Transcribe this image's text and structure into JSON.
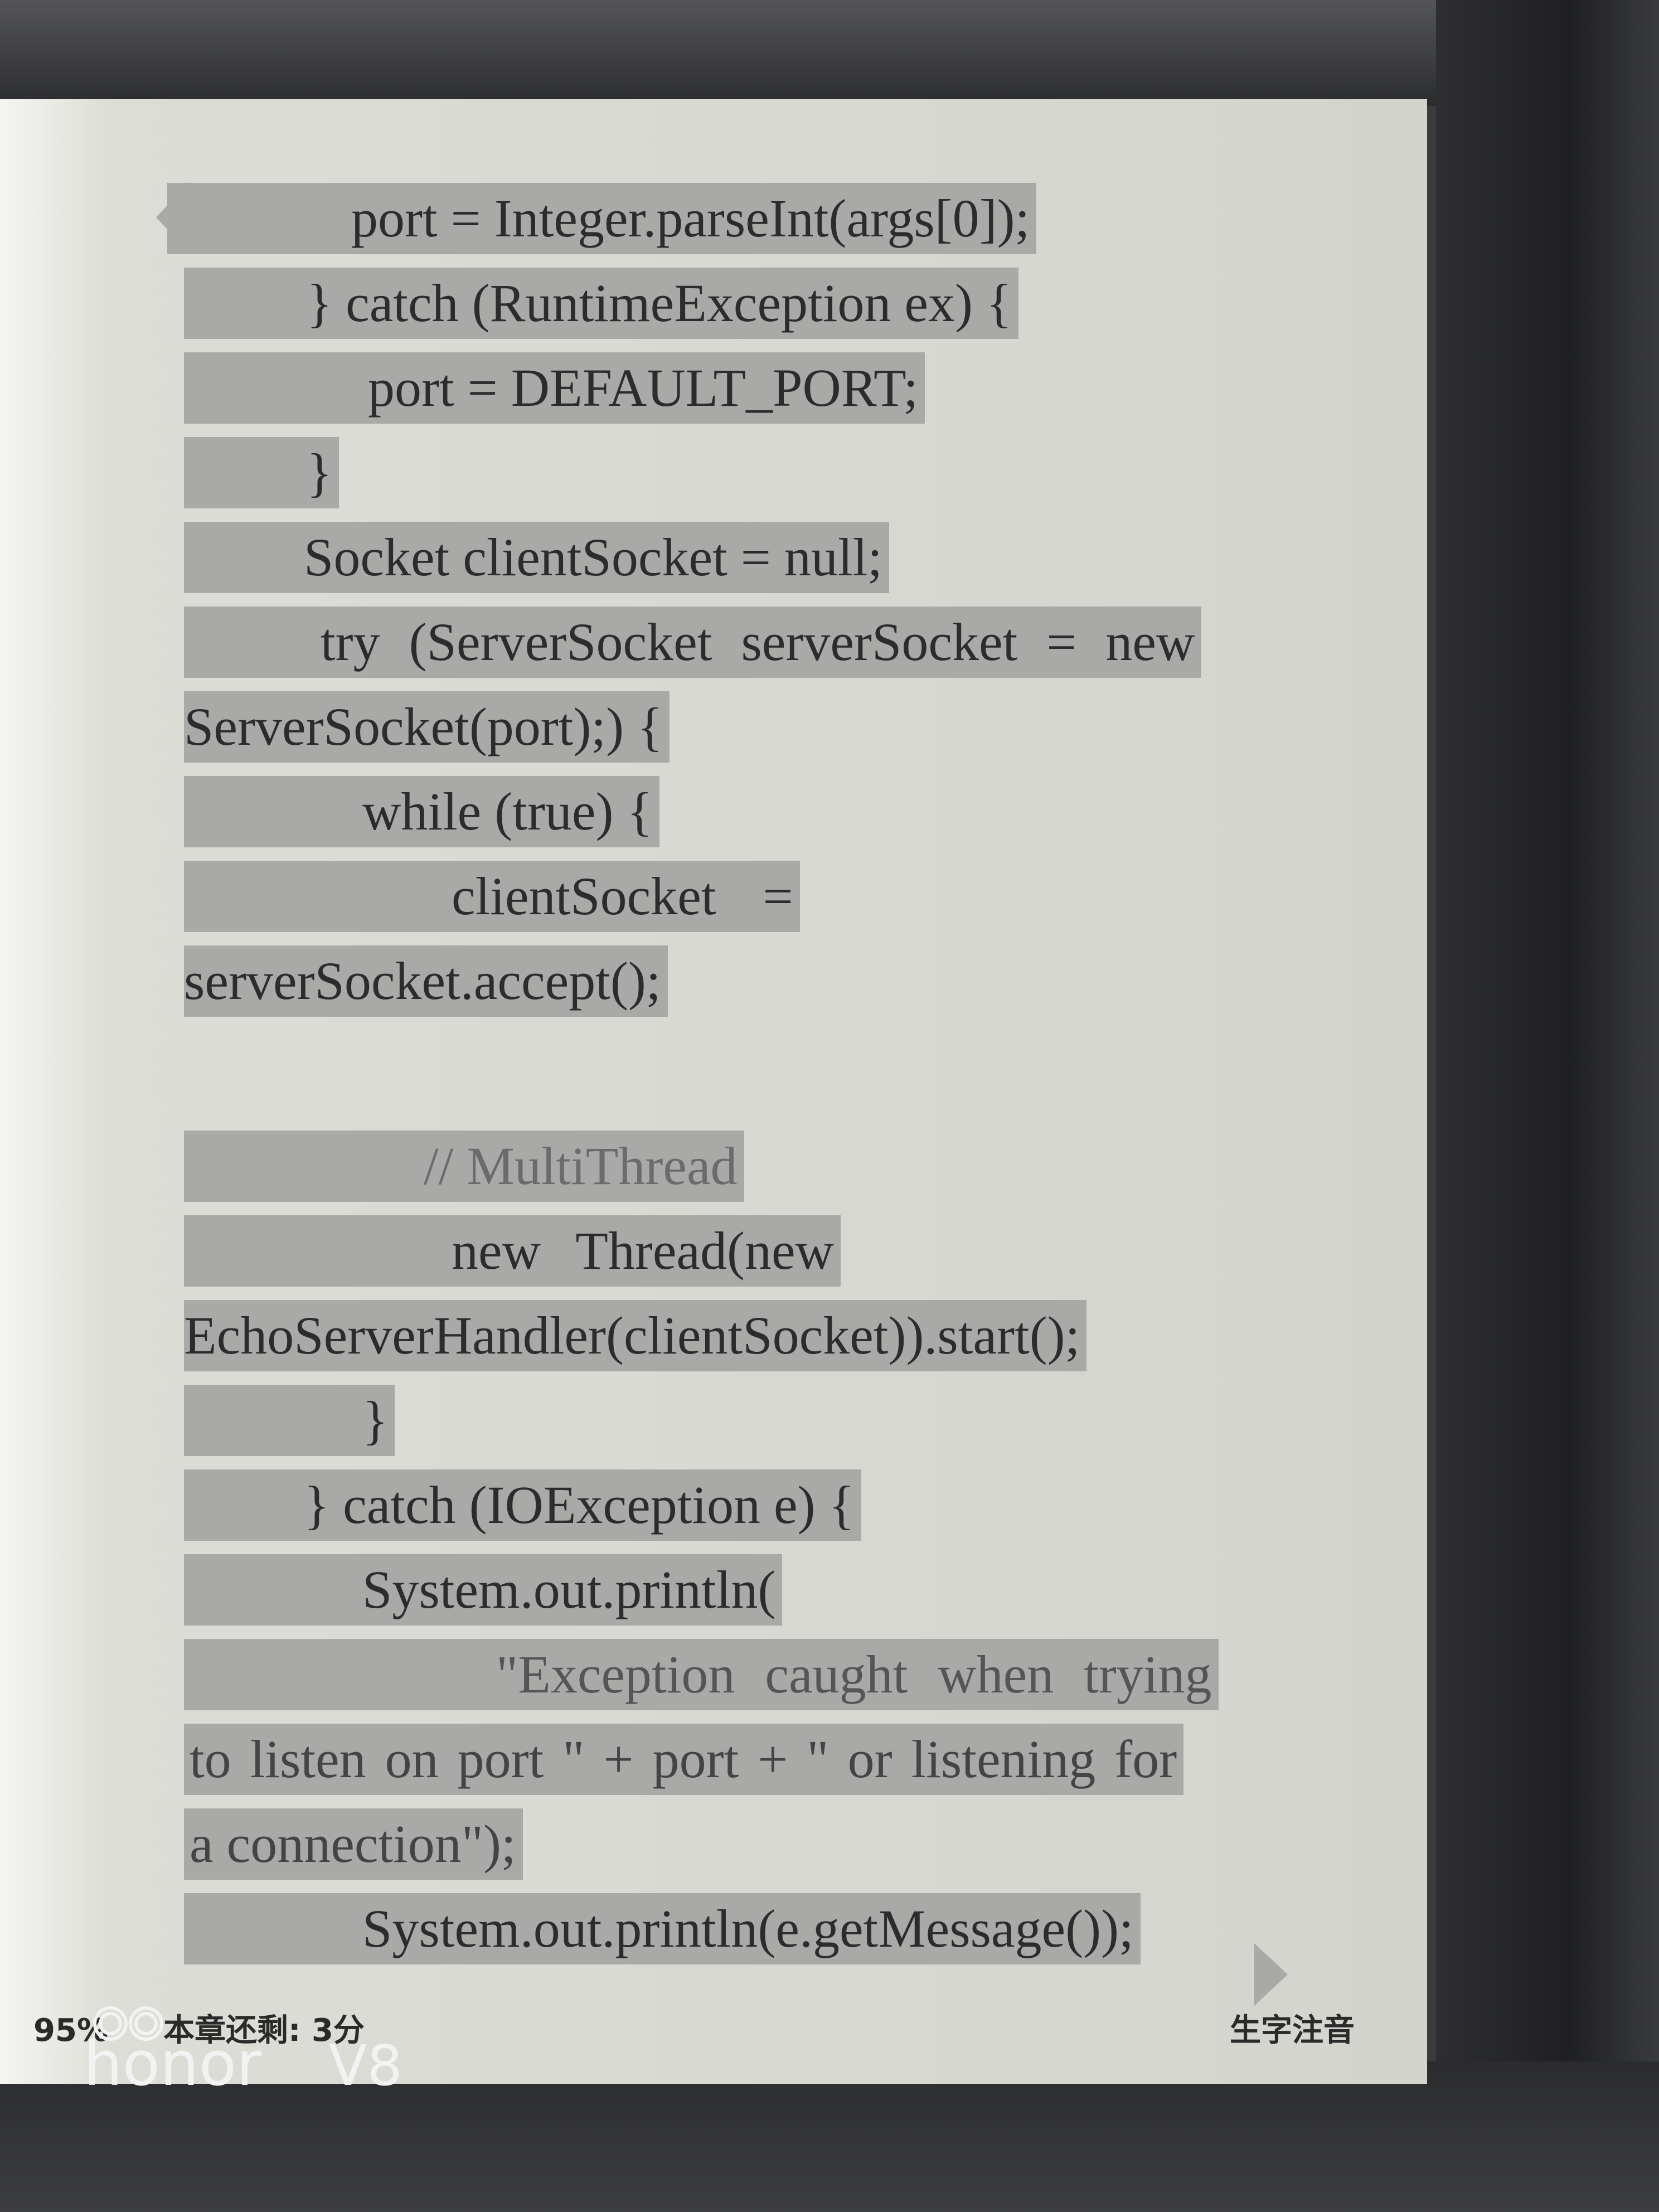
{
  "code_lines": [
    "port = Integer.parseInt(args[0]);",
    "} catch (RuntimeException ex) {",
    "port = DEFAULT_PORT;",
    "}",
    "Socket clientSocket = null;",
    "try (ServerSocket serverSocket = new",
    "ServerSocket(port);) {",
    "while (true) {",
    "clientSocket =",
    "serverSocket.accept();",
    "// MultiThread",
    "new Thread(new",
    "EchoServerHandler(clientSocket)).start();",
    "}",
    "} catch (IOException e) {",
    "System.out.println(",
    "\"Exception caught when trying",
    "to listen on port \" + port + \" or listening for",
    "a connection\");",
    "System.out.println(e.getMessage());"
  ],
  "status_bar": {
    "progress": "95%",
    "chapter_remaining": "本章还剩: 3分",
    "feature": "生字注音"
  },
  "watermark": {
    "brand": "honor",
    "model": "V8"
  },
  "colors": {
    "highlight": "#a9aaa7",
    "screen": "#d3d4ce",
    "bezel": "#2d2e30"
  }
}
